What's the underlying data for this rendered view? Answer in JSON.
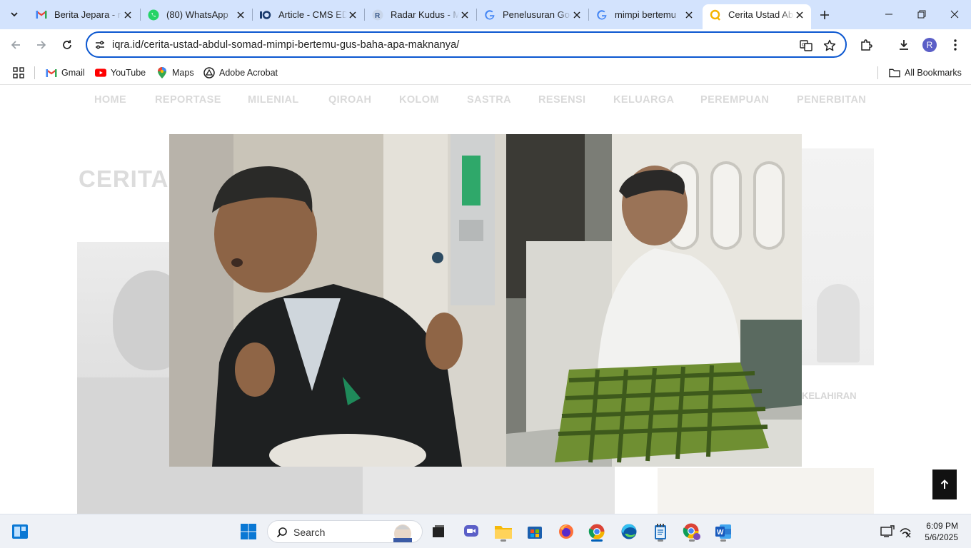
{
  "browser": {
    "tabs": [
      {
        "title": "Berita Jepara - re",
        "icon": "gmail-icon"
      },
      {
        "title": "(80) WhatsApp",
        "icon": "whatsapp-icon"
      },
      {
        "title": "Article - CMS ED",
        "icon": "cms-icon"
      },
      {
        "title": "Radar Kudus - M",
        "icon": "radar-icon"
      },
      {
        "title": "Penelusuran Goo",
        "icon": "google-icon"
      },
      {
        "title": "mimpi bertemu",
        "icon": "google-icon"
      },
      {
        "title": "Cerita Ustad Ab",
        "icon": "iqra-icon",
        "active": true
      }
    ],
    "url": "iqra.id/cerita-ustad-abdul-somad-mimpi-bertemu-gus-baha-apa-maknanya/",
    "profile_initial": "R",
    "bookmarks": [
      {
        "label": "Gmail",
        "icon": "gmail-icon"
      },
      {
        "label": "YouTube",
        "icon": "youtube-icon"
      },
      {
        "label": "Maps",
        "icon": "maps-icon"
      },
      {
        "label": "Adobe Acrobat",
        "icon": "acrobat-icon"
      }
    ],
    "all_bookmarks": "All Bookmarks"
  },
  "site": {
    "nav": [
      "HOME",
      "REPORTASE",
      "MILENIAL",
      "QIROAH",
      "KOLOM",
      "SASTRA",
      "RESENSI",
      "KELUARGA",
      "PEREMPUAN",
      "PENERBITAN"
    ],
    "bg_title": "CERITA",
    "bg_caption": "KELAHIRAN"
  },
  "taskbar": {
    "search_label": "Search",
    "time": "6:09 PM",
    "date": "5/6/2025"
  }
}
